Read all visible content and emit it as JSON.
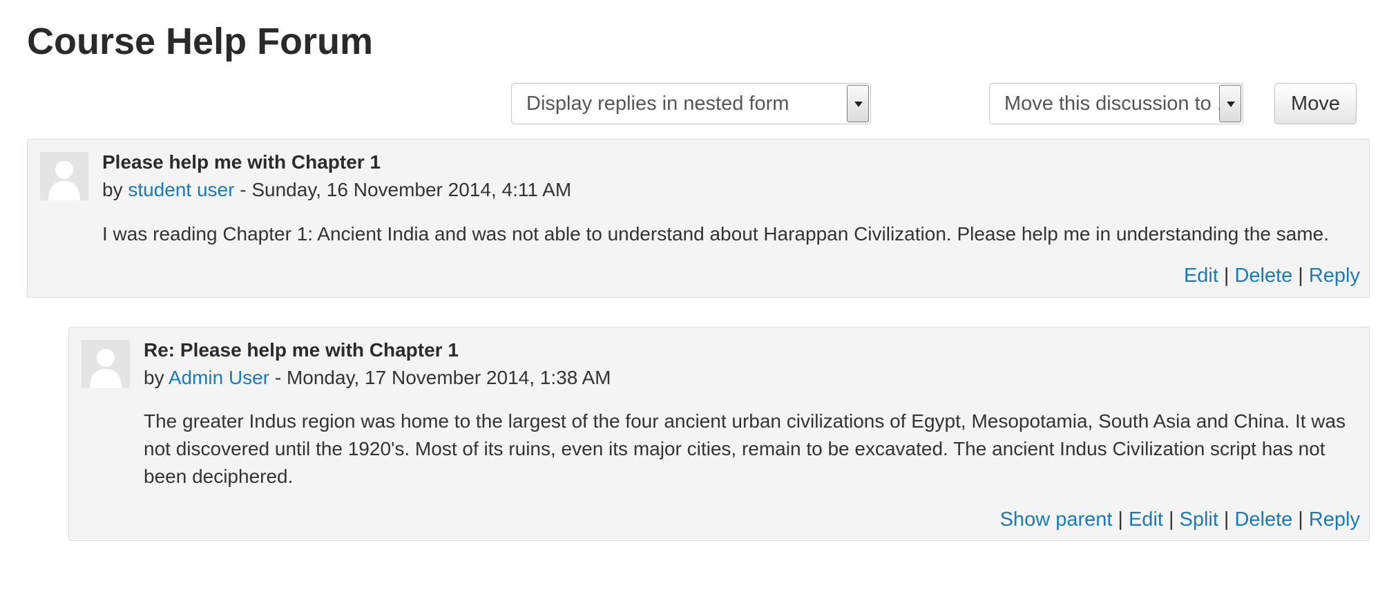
{
  "page": {
    "title": "Course Help Forum"
  },
  "controls": {
    "display_mode": {
      "selected": "Display replies in nested form"
    },
    "move_discussion": {
      "selected": "Move this discussion to ..."
    },
    "move_button": "Move"
  },
  "posts": [
    {
      "subject": "Please help me with Chapter 1",
      "by": "by",
      "author": "student user",
      "date": "- Sunday, 16 November 2014, 4:11 AM",
      "body": "I was reading Chapter 1: Ancient India and was not able to understand about Harappan Civilization. Please help me in understanding the same.",
      "commands": [
        "Edit",
        "Delete",
        "Reply"
      ]
    },
    {
      "subject": "Re: Please help me with Chapter 1",
      "by": "by",
      "author": "Admin User",
      "date": "- Monday, 17 November 2014, 1:38 AM",
      "body": "The greater Indus region was home to the largest of the four ancient urban civilizations of Egypt, Mesopotamia, South Asia and China. It was not discovered until the 1920's. Most of its ruins, even its major cities, remain to be excavated. The ancient Indus Civilization script has not been deciphered.",
      "commands": [
        "Show parent",
        "Edit",
        "Split",
        "Delete",
        "Reply"
      ]
    }
  ],
  "separator": "|",
  "icons": {
    "avatar": "user-avatar-placeholder-icon",
    "select_arrow": "chevron-down-icon"
  },
  "colors": {
    "link": "#1a7ab8",
    "post_background": "#f4f4f4"
  }
}
